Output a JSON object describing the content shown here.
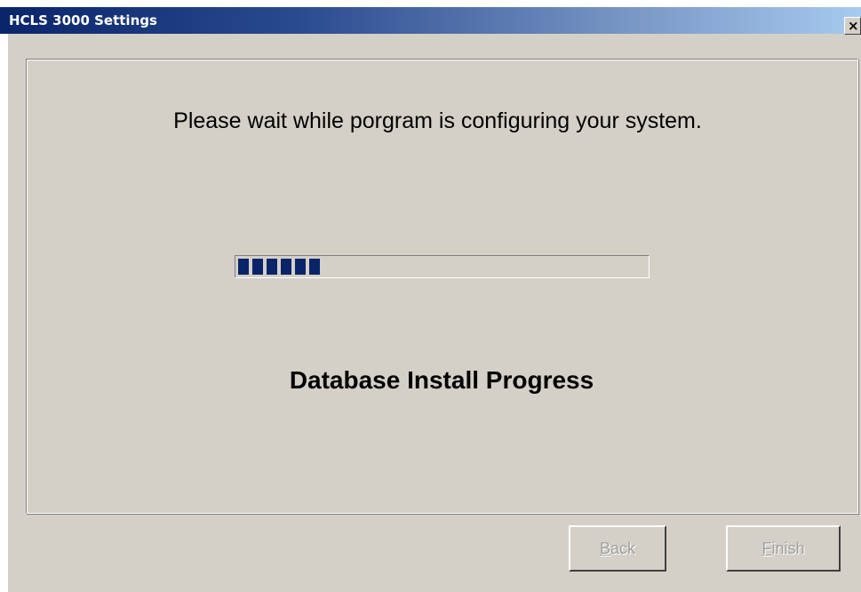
{
  "window": {
    "title": "HCLS 3000 Settings",
    "close_glyph": "×"
  },
  "main": {
    "message": "Please wait while porgram is configuring your system.",
    "progress_label": "Database Install Progress",
    "progress_fraction": 0.2
  },
  "buttons": {
    "back": {
      "mnemonic": "B",
      "rest": "ack",
      "enabled": false
    },
    "finish": {
      "mnemonic": "F",
      "rest": "inish",
      "enabled": false
    }
  },
  "colors": {
    "title_start": "#0a246a",
    "title_end": "#a6caf0",
    "progress_fill": "#0a246a",
    "dialog_bg": "#d4d0c8"
  }
}
